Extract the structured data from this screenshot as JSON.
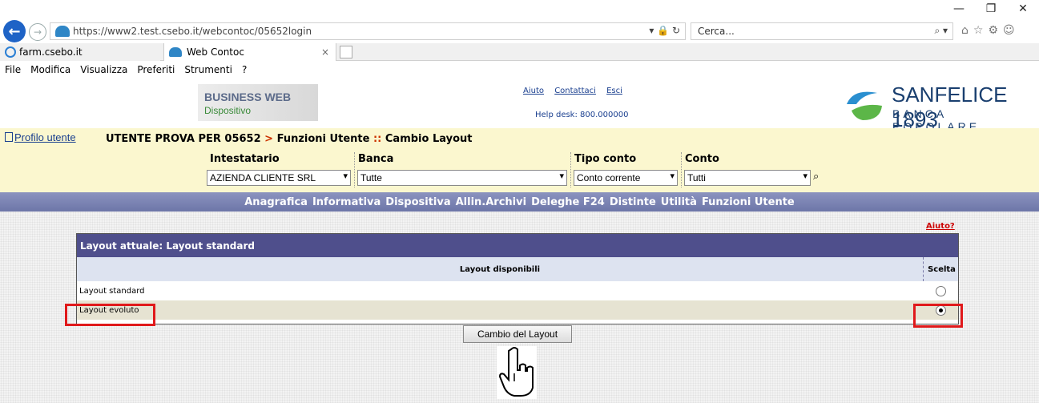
{
  "browser": {
    "url": "https://www2.test.csebo.it/webcontoc/05652login",
    "url_domain": "csebo.it",
    "search_placeholder": "Cerca...",
    "tabs": [
      {
        "label": "farm.csebo.it"
      },
      {
        "label": "Web Contoc"
      }
    ],
    "menu": [
      "File",
      "Modifica",
      "Visualizza",
      "Preferiti",
      "Strumenti",
      "?"
    ]
  },
  "header": {
    "business_title": "BUSINESS WEB",
    "business_subtitle": "Dispositivo",
    "links": [
      "Aiuto",
      "Contattaci",
      "Esci"
    ],
    "helpdesk": "Help desk: 800.000000",
    "bank_name": "SANFELICE 1893",
    "bank_subtitle": "BANCA POPOLARE"
  },
  "breadcrumb": {
    "profile": "Profilo utente",
    "user": "UTENTE PROVA PER 05652",
    "sep1": ">",
    "section": "Funzioni Utente",
    "sep2": "::",
    "page": "Cambio Layout"
  },
  "filters": {
    "intestatario_label": "Intestatario",
    "intestatario_value": "AZIENDA CLIENTE SRL",
    "banca_label": "Banca",
    "banca_value": "Tutte",
    "tipo_label": "Tipo conto",
    "tipo_value": "Conto corrente",
    "conto_label": "Conto",
    "conto_value": "Tutti"
  },
  "nav": [
    "Anagrafica",
    "Informativa",
    "Dispositiva",
    "Allin.Archivi",
    "Deleghe F24",
    "Distinte",
    "Utilità",
    "Funzioni Utente"
  ],
  "content": {
    "help_link": "Aiuto?",
    "panel_title": "Layout attuale: Layout standard",
    "col_available": "Layout disponibili",
    "col_choice": "Scelta",
    "rows": [
      {
        "label": "Layout standard",
        "selected": false
      },
      {
        "label": "Layout evoluto",
        "selected": true
      }
    ],
    "submit_label": "Cambio del Layout"
  },
  "colors": {
    "panel_header": "#4f4f8c",
    "nav_bar": "#6d76a8",
    "highlight": "#e0191b"
  }
}
